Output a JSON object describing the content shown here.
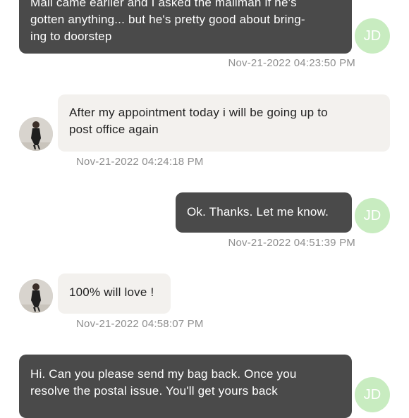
{
  "messages": [
    {
      "direction": "outgoing",
      "lines": [
        "Mail came earlier and I asked the mailman if he's",
        "gotten anything... but he's pretty good about bring-",
        "ing to doorstep"
      ],
      "timestamp": "Nov-21-2022 04:23:50 PM",
      "avatar_initials": "JD"
    },
    {
      "direction": "incoming",
      "lines": [
        "After my appointment today i will be going up to",
        "post office again"
      ],
      "timestamp": "Nov-21-2022 04:24:18 PM"
    },
    {
      "direction": "outgoing",
      "lines": [
        "Ok. Thanks. Let me know."
      ],
      "timestamp": "Nov-21-2022 04:51:39 PM",
      "avatar_initials": "JD"
    },
    {
      "direction": "incoming",
      "lines": [
        "100% will love !"
      ],
      "timestamp": "Nov-21-2022 04:58:07 PM"
    },
    {
      "direction": "outgoing",
      "lines": [
        "Hi. Can you please send my bag back. Once you",
        "resolve the postal issue. You'll get yours back"
      ],
      "avatar_initials": "JD"
    }
  ],
  "colors": {
    "outgoing_bubble": "#4a4a4a",
    "incoming_bubble": "#f3f1ee",
    "avatar_initials_bg": "#c8ecc0",
    "timestamp": "#8e8e8e"
  },
  "icons": {
    "incoming_avatar": "user-photo-avatar"
  }
}
